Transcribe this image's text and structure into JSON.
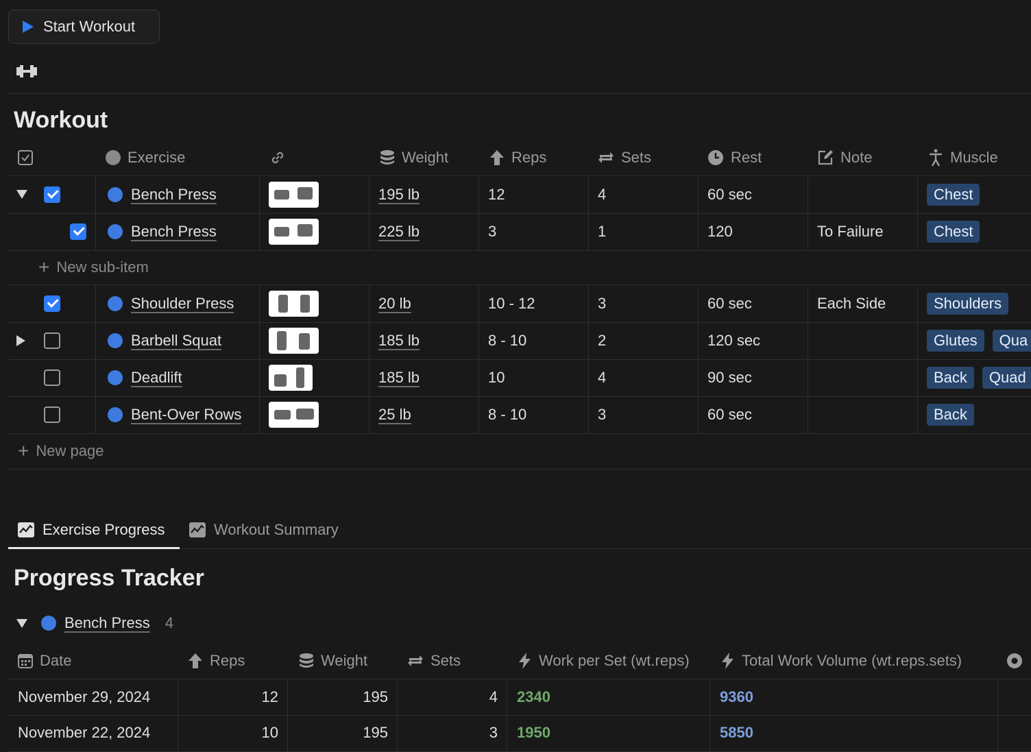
{
  "start_button": {
    "label": "Start Workout"
  },
  "workout": {
    "title": "Workout",
    "headers": {
      "exercise": "Exercise",
      "weight": "Weight",
      "reps": "Reps",
      "sets": "Sets",
      "rest": "Rest",
      "note": "Note",
      "muscle": "Muscle"
    },
    "rows": [
      {
        "name": "Bench Press",
        "weight": "195 lb",
        "reps": "12",
        "sets": "4",
        "rest": "60 sec",
        "note": "",
        "muscle": [
          "Chest"
        ]
      },
      {
        "name": "Bench Press",
        "weight": "225 lb",
        "reps": "3",
        "sets": "1",
        "rest": "120",
        "note": "To Failure",
        "muscle": [
          "Chest"
        ]
      },
      {
        "name": "Shoulder Press",
        "weight": "20 lb",
        "reps": "10 - 12",
        "sets": "3",
        "rest": "60 sec",
        "note": "Each Side",
        "muscle": [
          "Shoulders"
        ]
      },
      {
        "name": "Barbell Squat",
        "weight": "185 lb",
        "reps": "8 - 10",
        "sets": "2",
        "rest": "120 sec",
        "note": "",
        "muscle": [
          "Glutes",
          "Qua"
        ]
      },
      {
        "name": "Deadlift",
        "weight": "185 lb",
        "reps": "10",
        "sets": "4",
        "rest": "90 sec",
        "note": "",
        "muscle": [
          "Back",
          "Quad"
        ]
      },
      {
        "name": "Bent-Over Rows",
        "weight": "25 lb",
        "reps": "8 - 10",
        "sets": "3",
        "rest": "60 sec",
        "note": "",
        "muscle": [
          "Back"
        ]
      }
    ],
    "new_sub_item": "New sub-item",
    "new_page": "New page"
  },
  "tabs": [
    {
      "label": "Exercise Progress",
      "active": true
    },
    {
      "label": "Workout Summary",
      "active": false
    }
  ],
  "progress": {
    "title": "Progress Tracker",
    "group": {
      "name": "Bench Press",
      "count": "4"
    },
    "headers": {
      "date": "Date",
      "reps": "Reps",
      "weight": "Weight",
      "sets": "Sets",
      "work_per_set": "Work per Set (wt.reps)",
      "total_volume": "Total Work Volume (wt.reps.sets)"
    },
    "rows": [
      {
        "date": "November 29, 2024",
        "reps": "12",
        "weight": "195",
        "sets": "4",
        "work_per_set": "2340",
        "total_volume": "9360"
      },
      {
        "date": "November 22, 2024",
        "reps": "10",
        "weight": "195",
        "sets": "3",
        "work_per_set": "1950",
        "total_volume": "5850"
      }
    ]
  },
  "colors": {
    "accent": "#2e7cf6",
    "tag_bg": "#28456c",
    "green": "#6fa96a",
    "blue": "#7b9fdb"
  }
}
